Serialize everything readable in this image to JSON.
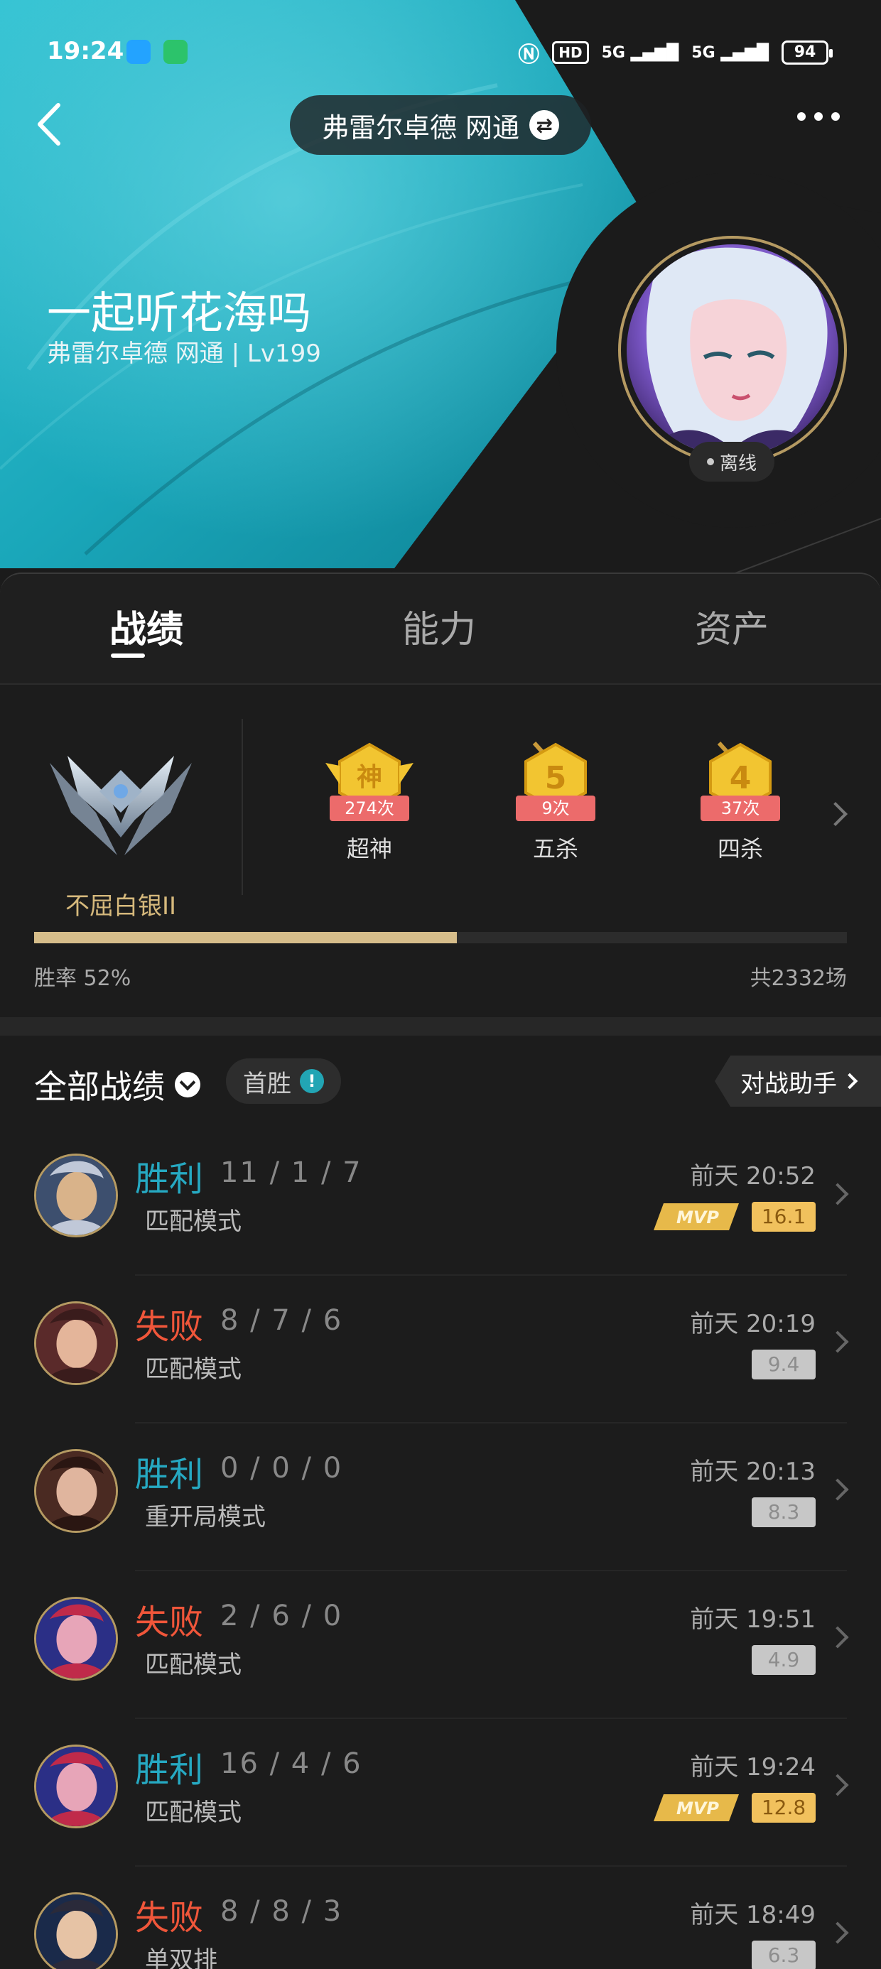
{
  "status_bar": {
    "time": "19:24",
    "hd_label": "HD",
    "net1": "5G",
    "net2": "5G",
    "battery": "94",
    "icons": [
      "qq-icon",
      "chat-app-icon",
      "nfc-icon",
      "hd-icon",
      "signal-icon",
      "signal-icon",
      "battery-icon"
    ]
  },
  "header": {
    "server_name": "弗雷尔卓德 网通",
    "nickname": "一起听花海吗",
    "subline": "弗雷尔卓德 网通 | Lv199",
    "status": "离线"
  },
  "tabs": [
    {
      "label": "战绩",
      "active": true
    },
    {
      "label": "能力",
      "active": false
    },
    {
      "label": "资产",
      "active": false
    }
  ],
  "stats": {
    "rank": "不屈白银II",
    "medals": [
      {
        "glyph": "神",
        "count": "274次",
        "name": "超神"
      },
      {
        "glyph": "5",
        "count": "9次",
        "name": "五杀"
      },
      {
        "glyph": "4",
        "count": "37次",
        "name": "四杀"
      }
    ],
    "win_rate_label": "胜率  52%",
    "win_rate": 0.52,
    "total": "共2332场"
  },
  "list": {
    "title": "全部战绩",
    "first_win": "首胜",
    "assistant": "对战助手"
  },
  "matches": [
    {
      "result": "胜利",
      "win": true,
      "kda": "11 / 1 / 7",
      "mode": "匹配模式",
      "time": "前天 20:52",
      "score": "16.1",
      "mvp": true
    },
    {
      "result": "失败",
      "win": false,
      "kda": "8 / 7 / 6",
      "mode": "匹配模式",
      "time": "前天 20:19",
      "score": "9.4",
      "mvp": false
    },
    {
      "result": "胜利",
      "win": true,
      "kda": "0 / 0 / 0",
      "mode": "重开局模式",
      "time": "前天 20:13",
      "score": "8.3",
      "mvp": false
    },
    {
      "result": "失败",
      "win": false,
      "kda": "2 / 6 / 0",
      "mode": "匹配模式",
      "time": "前天 19:51",
      "score": "4.9",
      "mvp": false
    },
    {
      "result": "胜利",
      "win": true,
      "kda": "16 / 4 / 6",
      "mode": "匹配模式",
      "time": "前天 19:24",
      "score": "12.8",
      "mvp": true
    },
    {
      "result": "失败",
      "win": false,
      "kda": "8 / 8 / 3",
      "mode": "单双排",
      "time": "前天 18:49",
      "score": "6.3",
      "mvp": false
    }
  ],
  "mvp_label": "MVP"
}
